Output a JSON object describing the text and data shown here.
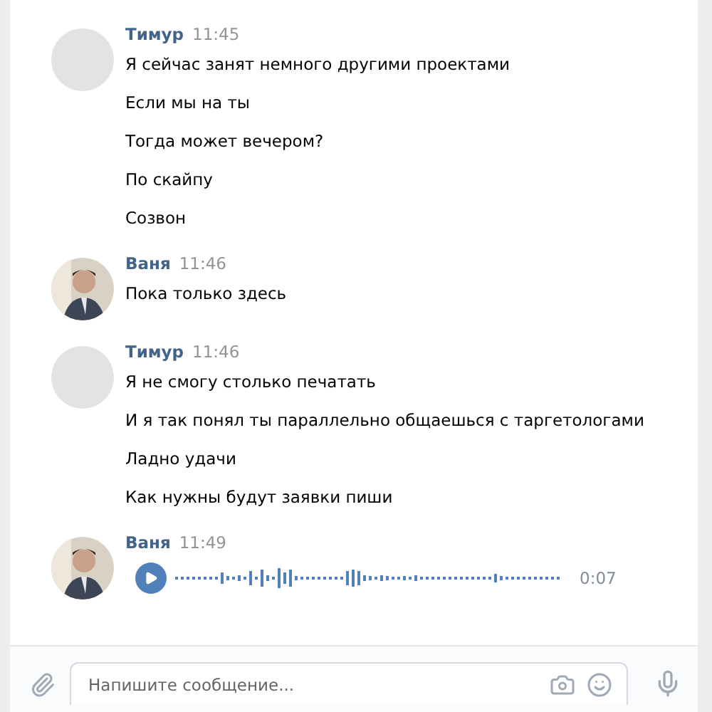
{
  "messages": [
    {
      "author": "Тимур",
      "time": "11:45",
      "avatar": {
        "kind": "placeholder"
      },
      "items": [
        {
          "kind": "text",
          "text": "Я сейчас занят немного другими проектами"
        },
        {
          "kind": "text",
          "text": "Если мы на ты"
        },
        {
          "kind": "text",
          "text": "Тогда может вечером?"
        },
        {
          "kind": "text",
          "text": "По скайпу"
        },
        {
          "kind": "text",
          "text": "Созвон"
        }
      ]
    },
    {
      "author": "Ваня",
      "time": "11:46",
      "items": [
        {
          "kind": "text",
          "text": "Пока только здесь"
        }
      ]
    },
    {
      "author": "Тимур",
      "time": "11:46",
      "avatar": {
        "kind": "placeholder"
      },
      "items": [
        {
          "kind": "text",
          "text": "Я не смогу столько печатать"
        },
        {
          "kind": "text",
          "text": "И я так понял ты параллельно общаешься с таргетологами"
        },
        {
          "kind": "text",
          "text": "Ладно удачи"
        },
        {
          "kind": "text",
          "text": "Как нужны будут заявки пиши"
        }
      ]
    },
    {
      "author": "Ваня",
      "time": "11:49",
      "items": [
        {
          "kind": "voice",
          "duration": "0:07"
        }
      ]
    }
  ],
  "composer": {
    "placeholder": "Напишите сообщение..."
  }
}
